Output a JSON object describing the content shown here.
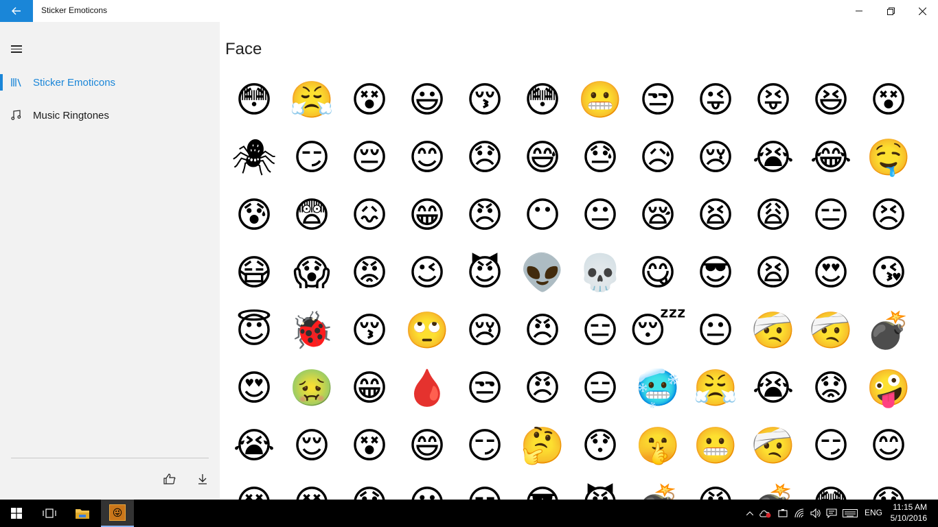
{
  "window": {
    "title": "Sticker Emoticons"
  },
  "sidebar": {
    "items": [
      {
        "label": "Sticker Emoticons",
        "icon": "library-icon",
        "active": true
      },
      {
        "label": "Music Ringtones",
        "icon": "music-note-icon",
        "active": false
      }
    ],
    "footer": [
      {
        "icon": "like-icon"
      },
      {
        "icon": "download-icon"
      }
    ]
  },
  "main": {
    "title": "Face",
    "rows": [
      [
        "😳",
        "😤",
        "😵",
        "😃",
        "😚",
        "😳",
        "😬",
        "😒",
        "😜",
        "😝",
        "😆",
        "😵"
      ],
      [
        "🕷",
        "😏",
        "😔",
        "😊",
        "😞",
        "😅",
        "😓",
        "😥",
        "😢",
        "😭",
        "😂",
        "🤤"
      ],
      [
        "😰",
        "😨",
        "😖",
        "😁",
        "😠",
        "😶",
        "😐",
        "😪",
        "😫",
        "😩",
        "😑",
        "😣"
      ],
      [
        "😷",
        "😱",
        "😡",
        "😉",
        "😈",
        "👽",
        "💀",
        "😋",
        "😎",
        "😫",
        "😍",
        "😘"
      ],
      [
        "😇",
        "🐞",
        "😚",
        "🙄",
        "😢",
        "😠",
        "😑",
        "😴",
        "😐",
        "🤕",
        "🤕",
        "💣"
      ],
      [
        "😍",
        "🤢",
        "😁",
        "🩸",
        "😒",
        "😠",
        "😑",
        "🥶",
        "😤",
        "😭",
        "😟",
        "🤪"
      ],
      [
        "😭",
        "😌",
        "😵",
        "😄",
        "😏",
        "🤔",
        "😯",
        "🤫",
        "😬",
        "🤕",
        "😏",
        "😊"
      ],
      [
        "😵",
        "😵",
        "😰",
        "😃",
        "😏",
        "😎",
        "😈",
        "💣",
        "😠",
        "💣",
        "😳",
        "😰"
      ]
    ]
  },
  "taskbar": {
    "lang": "ENG",
    "time": "11:15 AM",
    "date": "5/10/2016"
  },
  "colors": {
    "accent": "#1a86d8",
    "sidebar_bg": "#f2f2f2",
    "taskbar_bg": "#000000"
  }
}
